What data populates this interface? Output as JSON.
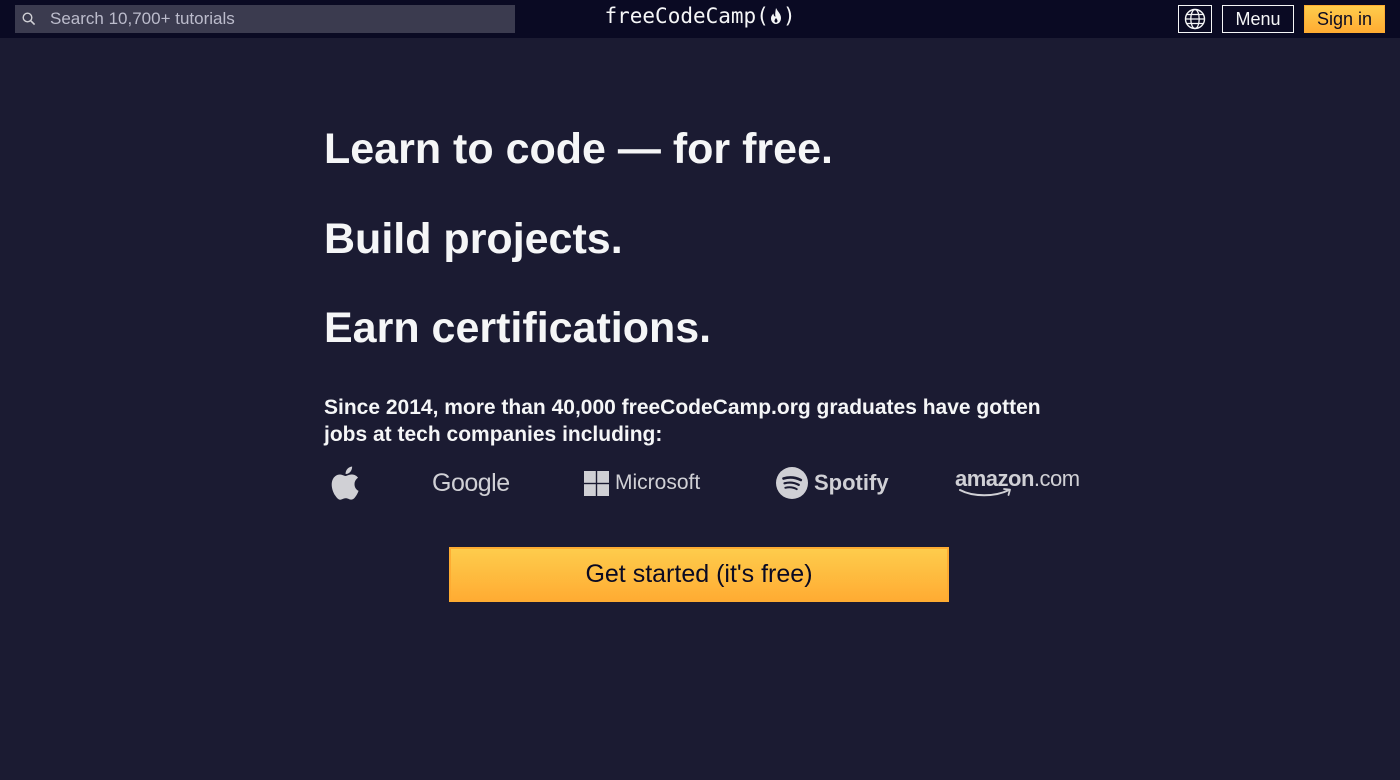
{
  "header": {
    "search_placeholder": "Search 10,700+ tutorials",
    "logo_text": "freeCodeCamp(",
    "logo_close": ")",
    "menu_label": "Menu",
    "signin_label": "Sign in",
    "language_icon": "globe-icon"
  },
  "hero": {
    "headline_1": "Learn to code — for free.",
    "headline_2": "Build projects.",
    "headline_3": "Earn certifications.",
    "blurb": "Since 2014, more than 40,000 freeCodeCamp.org graduates have gotten jobs at tech companies including:",
    "companies": [
      {
        "name": "Apple",
        "icon": "apple-logo-icon"
      },
      {
        "name": "Google",
        "text": "Google"
      },
      {
        "name": "Microsoft",
        "text": "Microsoft",
        "icon": "windows-logo-icon"
      },
      {
        "name": "Spotify",
        "text": "Spotify",
        "icon": "spotify-logo-icon"
      },
      {
        "name": "Amazon",
        "text_bold": "amazon",
        "text_suffix": ".com"
      }
    ],
    "cta_label": "Get started (it's free)"
  },
  "colors": {
    "background": "#1b1b32",
    "nav_background": "#0a0a23",
    "search_background": "#3b3b4f",
    "accent": "#feac32",
    "text": "#f5f6f7"
  }
}
